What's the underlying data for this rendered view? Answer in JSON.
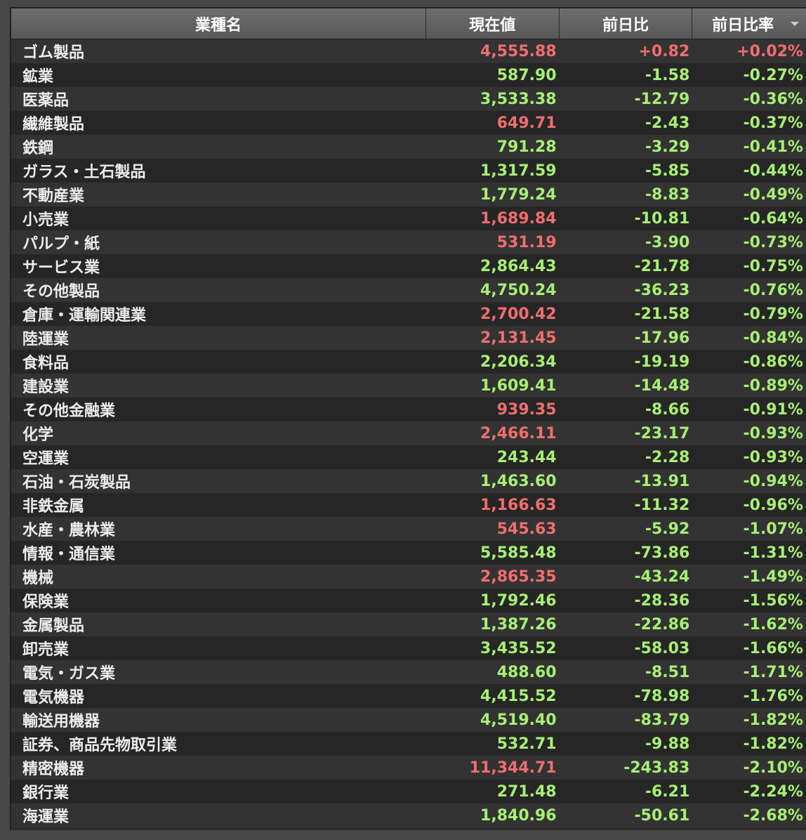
{
  "headers": {
    "name": "業種名",
    "price": "現在値",
    "change": "前日比",
    "change_pct": "前日比率"
  },
  "sort_icon": "chevron-down-icon",
  "colors": {
    "up": "#f26e6e",
    "down": "#a7ef74",
    "header_bg": "#626262",
    "row_odd": "#333333",
    "row_even": "#262626"
  },
  "rows": [
    {
      "name": "ゴム製品",
      "price": "4,555.88",
      "change": "+0.82",
      "pct": "+0.02%",
      "price_dir": "up",
      "chg_dir": "up"
    },
    {
      "name": "鉱業",
      "price": "587.90",
      "change": "-1.58",
      "pct": "-0.27%",
      "price_dir": "down",
      "chg_dir": "down"
    },
    {
      "name": "医薬品",
      "price": "3,533.38",
      "change": "-12.79",
      "pct": "-0.36%",
      "price_dir": "down",
      "chg_dir": "down"
    },
    {
      "name": "繊維製品",
      "price": "649.71",
      "change": "-2.43",
      "pct": "-0.37%",
      "price_dir": "up",
      "chg_dir": "down"
    },
    {
      "name": "鉄鋼",
      "price": "791.28",
      "change": "-3.29",
      "pct": "-0.41%",
      "price_dir": "down",
      "chg_dir": "down"
    },
    {
      "name": "ガラス・土石製品",
      "price": "1,317.59",
      "change": "-5.85",
      "pct": "-0.44%",
      "price_dir": "down",
      "chg_dir": "down"
    },
    {
      "name": "不動産業",
      "price": "1,779.24",
      "change": "-8.83",
      "pct": "-0.49%",
      "price_dir": "down",
      "chg_dir": "down"
    },
    {
      "name": "小売業",
      "price": "1,689.84",
      "change": "-10.81",
      "pct": "-0.64%",
      "price_dir": "up",
      "chg_dir": "down"
    },
    {
      "name": "パルプ・紙",
      "price": "531.19",
      "change": "-3.90",
      "pct": "-0.73%",
      "price_dir": "up",
      "chg_dir": "down"
    },
    {
      "name": "サービス業",
      "price": "2,864.43",
      "change": "-21.78",
      "pct": "-0.75%",
      "price_dir": "down",
      "chg_dir": "down"
    },
    {
      "name": "その他製品",
      "price": "4,750.24",
      "change": "-36.23",
      "pct": "-0.76%",
      "price_dir": "down",
      "chg_dir": "down"
    },
    {
      "name": "倉庫・運輸関連業",
      "price": "2,700.42",
      "change": "-21.58",
      "pct": "-0.79%",
      "price_dir": "up",
      "chg_dir": "down"
    },
    {
      "name": "陸運業",
      "price": "2,131.45",
      "change": "-17.96",
      "pct": "-0.84%",
      "price_dir": "up",
      "chg_dir": "down"
    },
    {
      "name": "食料品",
      "price": "2,206.34",
      "change": "-19.19",
      "pct": "-0.86%",
      "price_dir": "down",
      "chg_dir": "down"
    },
    {
      "name": "建設業",
      "price": "1,609.41",
      "change": "-14.48",
      "pct": "-0.89%",
      "price_dir": "down",
      "chg_dir": "down"
    },
    {
      "name": "その他金融業",
      "price": "939.35",
      "change": "-8.66",
      "pct": "-0.91%",
      "price_dir": "up",
      "chg_dir": "down"
    },
    {
      "name": "化学",
      "price": "2,466.11",
      "change": "-23.17",
      "pct": "-0.93%",
      "price_dir": "up",
      "chg_dir": "down"
    },
    {
      "name": "空運業",
      "price": "243.44",
      "change": "-2.28",
      "pct": "-0.93%",
      "price_dir": "down",
      "chg_dir": "down"
    },
    {
      "name": "石油・石炭製品",
      "price": "1,463.60",
      "change": "-13.91",
      "pct": "-0.94%",
      "price_dir": "down",
      "chg_dir": "down"
    },
    {
      "name": "非鉄金属",
      "price": "1,166.63",
      "change": "-11.32",
      "pct": "-0.96%",
      "price_dir": "up",
      "chg_dir": "down"
    },
    {
      "name": "水産・農林業",
      "price": "545.63",
      "change": "-5.92",
      "pct": "-1.07%",
      "price_dir": "up",
      "chg_dir": "down"
    },
    {
      "name": "情報・通信業",
      "price": "5,585.48",
      "change": "-73.86",
      "pct": "-1.31%",
      "price_dir": "down",
      "chg_dir": "down"
    },
    {
      "name": "機械",
      "price": "2,865.35",
      "change": "-43.24",
      "pct": "-1.49%",
      "price_dir": "up",
      "chg_dir": "down"
    },
    {
      "name": "保険業",
      "price": "1,792.46",
      "change": "-28.36",
      "pct": "-1.56%",
      "price_dir": "down",
      "chg_dir": "down"
    },
    {
      "name": "金属製品",
      "price": "1,387.26",
      "change": "-22.86",
      "pct": "-1.62%",
      "price_dir": "down",
      "chg_dir": "down"
    },
    {
      "name": "卸売業",
      "price": "3,435.52",
      "change": "-58.03",
      "pct": "-1.66%",
      "price_dir": "down",
      "chg_dir": "down"
    },
    {
      "name": "電気・ガス業",
      "price": "488.60",
      "change": "-8.51",
      "pct": "-1.71%",
      "price_dir": "down",
      "chg_dir": "down"
    },
    {
      "name": "電気機器",
      "price": "4,415.52",
      "change": "-78.98",
      "pct": "-1.76%",
      "price_dir": "down",
      "chg_dir": "down"
    },
    {
      "name": "輸送用機器",
      "price": "4,519.40",
      "change": "-83.79",
      "pct": "-1.82%",
      "price_dir": "down",
      "chg_dir": "down"
    },
    {
      "name": "証券、商品先物取引業",
      "price": "532.71",
      "change": "-9.88",
      "pct": "-1.82%",
      "price_dir": "down",
      "chg_dir": "down"
    },
    {
      "name": "精密機器",
      "price": "11,344.71",
      "change": "-243.83",
      "pct": "-2.10%",
      "price_dir": "up",
      "chg_dir": "down"
    },
    {
      "name": "銀行業",
      "price": "271.48",
      "change": "-6.21",
      "pct": "-2.24%",
      "price_dir": "down",
      "chg_dir": "down"
    },
    {
      "name": "海運業",
      "price": "1,840.96",
      "change": "-50.61",
      "pct": "-2.68%",
      "price_dir": "down",
      "chg_dir": "down"
    }
  ]
}
